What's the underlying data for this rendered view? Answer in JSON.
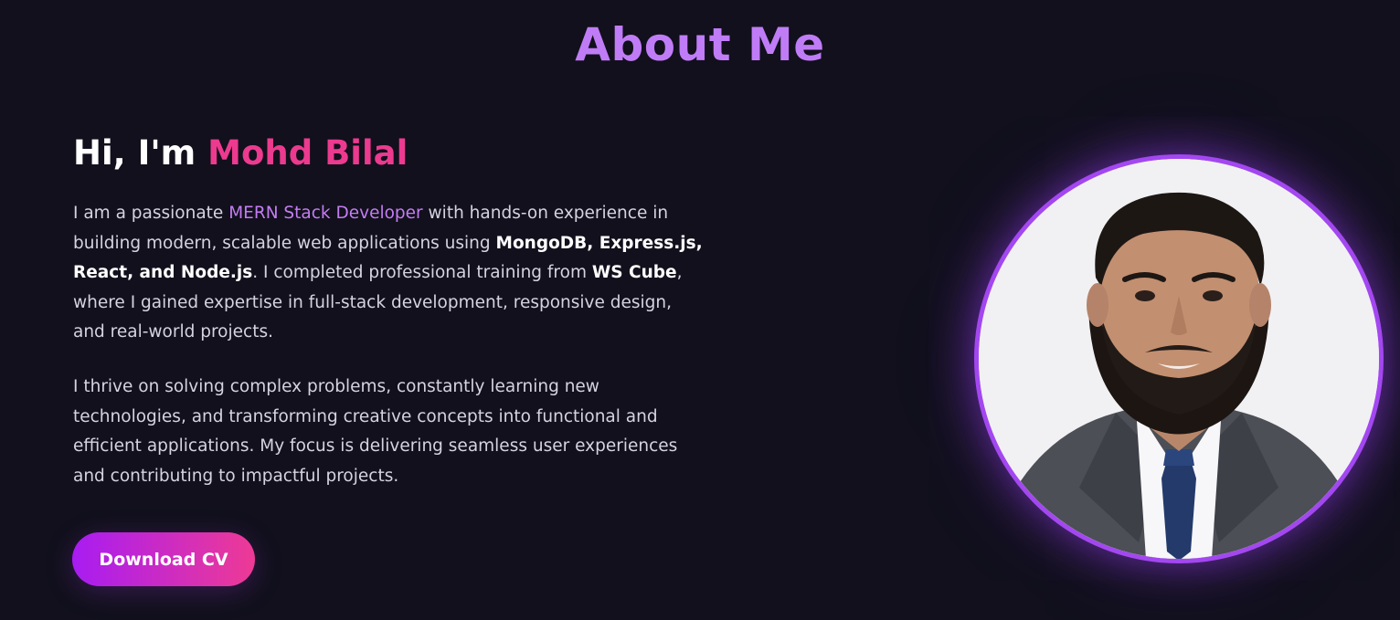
{
  "section": {
    "title": "About Me"
  },
  "intro": {
    "greeting": "Hi, I'm ",
    "name": "Mohd Bilal"
  },
  "bio": {
    "p1": {
      "t1": "I am a passionate ",
      "role": "MERN Stack Developer",
      "t2": " with hands-on experience in building modern, scalable web applications using ",
      "stack": "MongoDB, Express.js, React, and Node.js",
      "t3": ". I completed professional training from ",
      "institute": "WS Cube",
      "t4": ", where I gained expertise in full-stack development, responsive design, and real-world projects."
    },
    "p2": "I thrive on solving complex problems, constantly learning new technologies, and transforming creative concepts into functional and efficient applications. My focus is delivering seamless user experiences and contributing to impactful projects."
  },
  "cta": {
    "download_label": "Download CV"
  },
  "colors": {
    "background": "#11101c",
    "title": "#c07cf6",
    "name_accent": "#ec3a8f",
    "role_accent": "#c47cf3",
    "avatar_border": "#a347f0",
    "button_gradient_start": "#a81cf2",
    "button_gradient_end": "#ee3a95"
  }
}
